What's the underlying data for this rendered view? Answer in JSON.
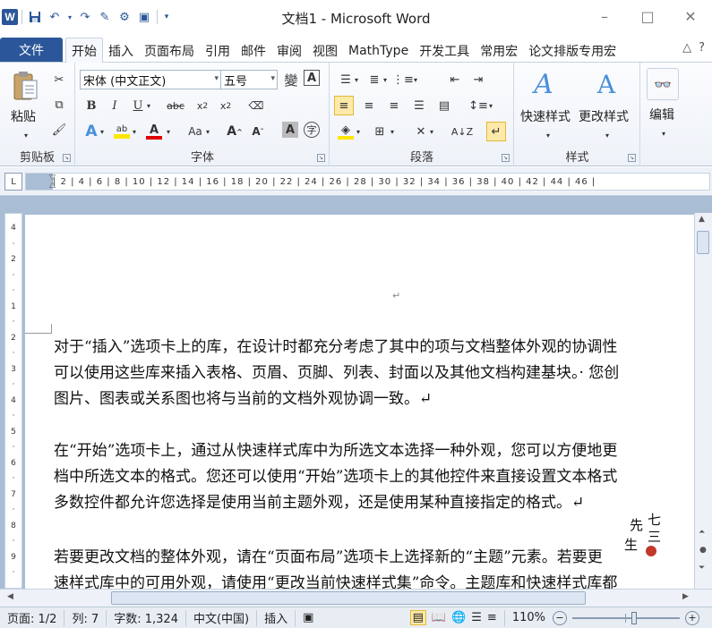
{
  "window": {
    "title": "文档1 - Microsoft Word",
    "controls": [
      "–",
      "□",
      "✕"
    ]
  },
  "qat": {
    "app_icon": "W",
    "save": "save-icon",
    "undo": "undo-icon",
    "redo": "redo-icon"
  },
  "tabs": {
    "file": "文件",
    "items": [
      "开始",
      "插入",
      "页面布局",
      "引用",
      "邮件",
      "审阅",
      "视图",
      "MathType",
      "开发工具",
      "常用宏",
      "论文排版专用宏"
    ],
    "right": [
      "△",
      "?"
    ]
  },
  "ribbon": {
    "clipboard": {
      "label": "剪贴板",
      "paste": "粘贴"
    },
    "font": {
      "label": "字体",
      "font_name": "宋体 (中文正文)",
      "font_size": "五号"
    },
    "paragraph": {
      "label": "段落"
    },
    "styles": {
      "label": "样式",
      "quick_styles": "快速样式",
      "change_styles": "更改样式"
    },
    "editing": {
      "label": "编辑",
      "edit": "编辑"
    }
  },
  "ruler": {
    "corner": "L",
    "ticks": "| 2 | 4 | 6 | 8 | 10 | 12 | 14 | 16 | 18 | 20 | 22 | 24 | 26 | 28 | 30 | 32 | 34 | 36 | 38 | 40 | 42 | 44 | 46 |",
    "vticks": [
      "4",
      "·",
      "2",
      "·",
      "·",
      "1",
      "·",
      "2",
      "·",
      "3",
      "·",
      "4",
      "·",
      "5",
      "·",
      "6",
      "·",
      "7",
      "·",
      "8",
      "·",
      "9",
      "·"
    ]
  },
  "document": {
    "pilcrow": "↵",
    "paragraphs": [
      [
        "对于“插入”选项卡上的库，在设计时都充分考虑了其中的项与文档整体外观的协调性",
        "可以使用这些库来插入表格、页眉、页脚、列表、封面以及其他文档构建基块。· 您创",
        "图片、图表或关系图也将与当前的文档外观协调一致。↵"
      ],
      [
        "在“开始”选项卡上，通过从快速样式库中为所选文本选择一种外观，您可以方便地更",
        "档中所选文本的格式。您还可以使用“开始”选项卡上的其他控件来直接设置文本格式",
        "多数控件都允许您选择是使用当前主题外观，还是使用某种直接指定的格式。↵"
      ],
      [
        "若要更改文档的整体外观，请在“页面布局”选项卡上选择新的“主题”元素。若要更",
        "速样式库中的可用外观，请使用“更改当前快速样式集”命令。主题库和快速样式库都"
      ]
    ]
  },
  "watermark": {
    "text": "七三先生",
    "accent": "#c0392b"
  },
  "status": {
    "page": "页面: 1/2",
    "column": "列: 7",
    "words": "字数: 1,324",
    "language": "中文(中国)",
    "mode": "插入",
    "zoom": "110%"
  },
  "colors": {
    "accent": "#2b579a",
    "highlight": "#ffe600",
    "font_color": "#e00000",
    "paper": "#ffffff",
    "canvas": "#a9bdd5"
  }
}
